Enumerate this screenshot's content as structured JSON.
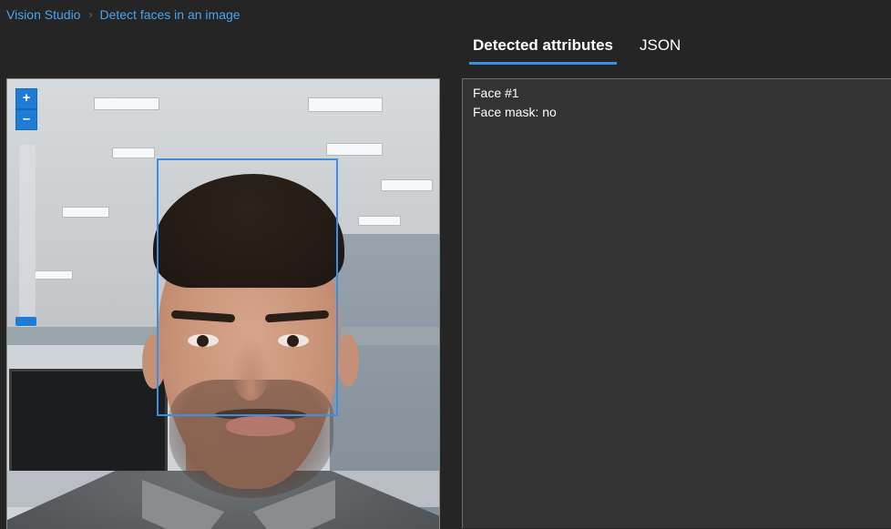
{
  "breadcrumb": {
    "root": "Vision Studio",
    "current": "Detect faces in an image"
  },
  "tabs": [
    {
      "label": "Detected attributes",
      "active": true
    },
    {
      "label": "JSON",
      "active": false
    }
  ],
  "image_panel": {
    "zoom_in_label": "+",
    "zoom_out_label": "–",
    "zoom_level_fraction": 0.05
  },
  "results": {
    "face_title": "Face #1",
    "face_mask": "Face mask: no"
  },
  "colors": {
    "accent": "#3a8ee6",
    "link": "#4aa3f0",
    "background": "#252525",
    "panel": "#333333"
  }
}
